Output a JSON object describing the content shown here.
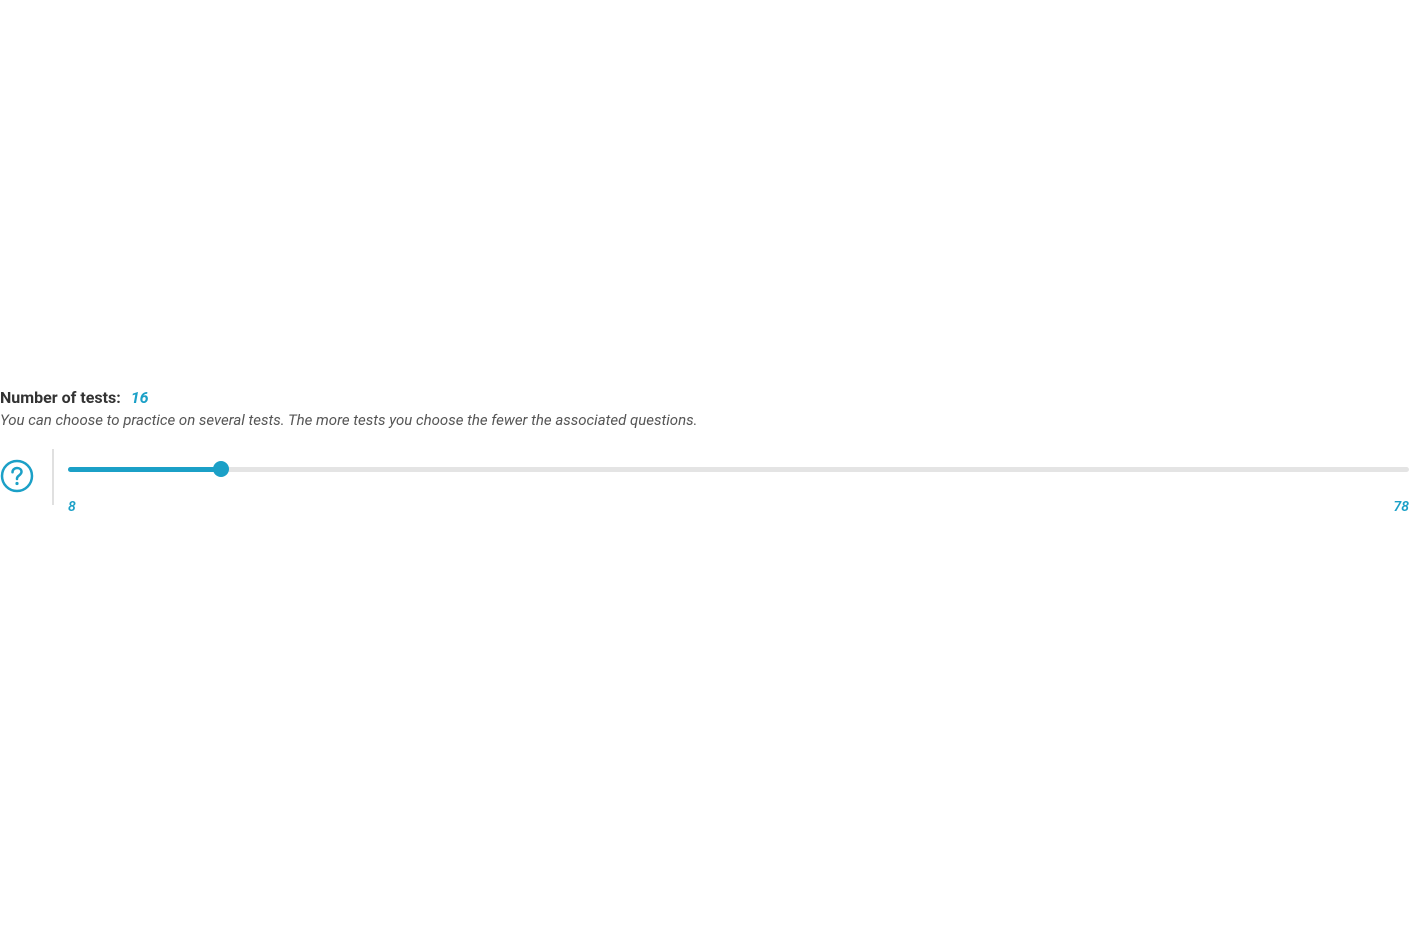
{
  "slider": {
    "label": "Number of tests:",
    "value": "16",
    "description": "You can choose to practice on several tests. The more tests you choose the fewer the associated questions.",
    "min": "8",
    "max": "78",
    "min_num": 8,
    "max_num": 78,
    "value_num": 16
  },
  "colors": {
    "accent": "#1ba0c7",
    "track": "#e4e4e4",
    "text": "#333333",
    "muted": "#555555"
  }
}
